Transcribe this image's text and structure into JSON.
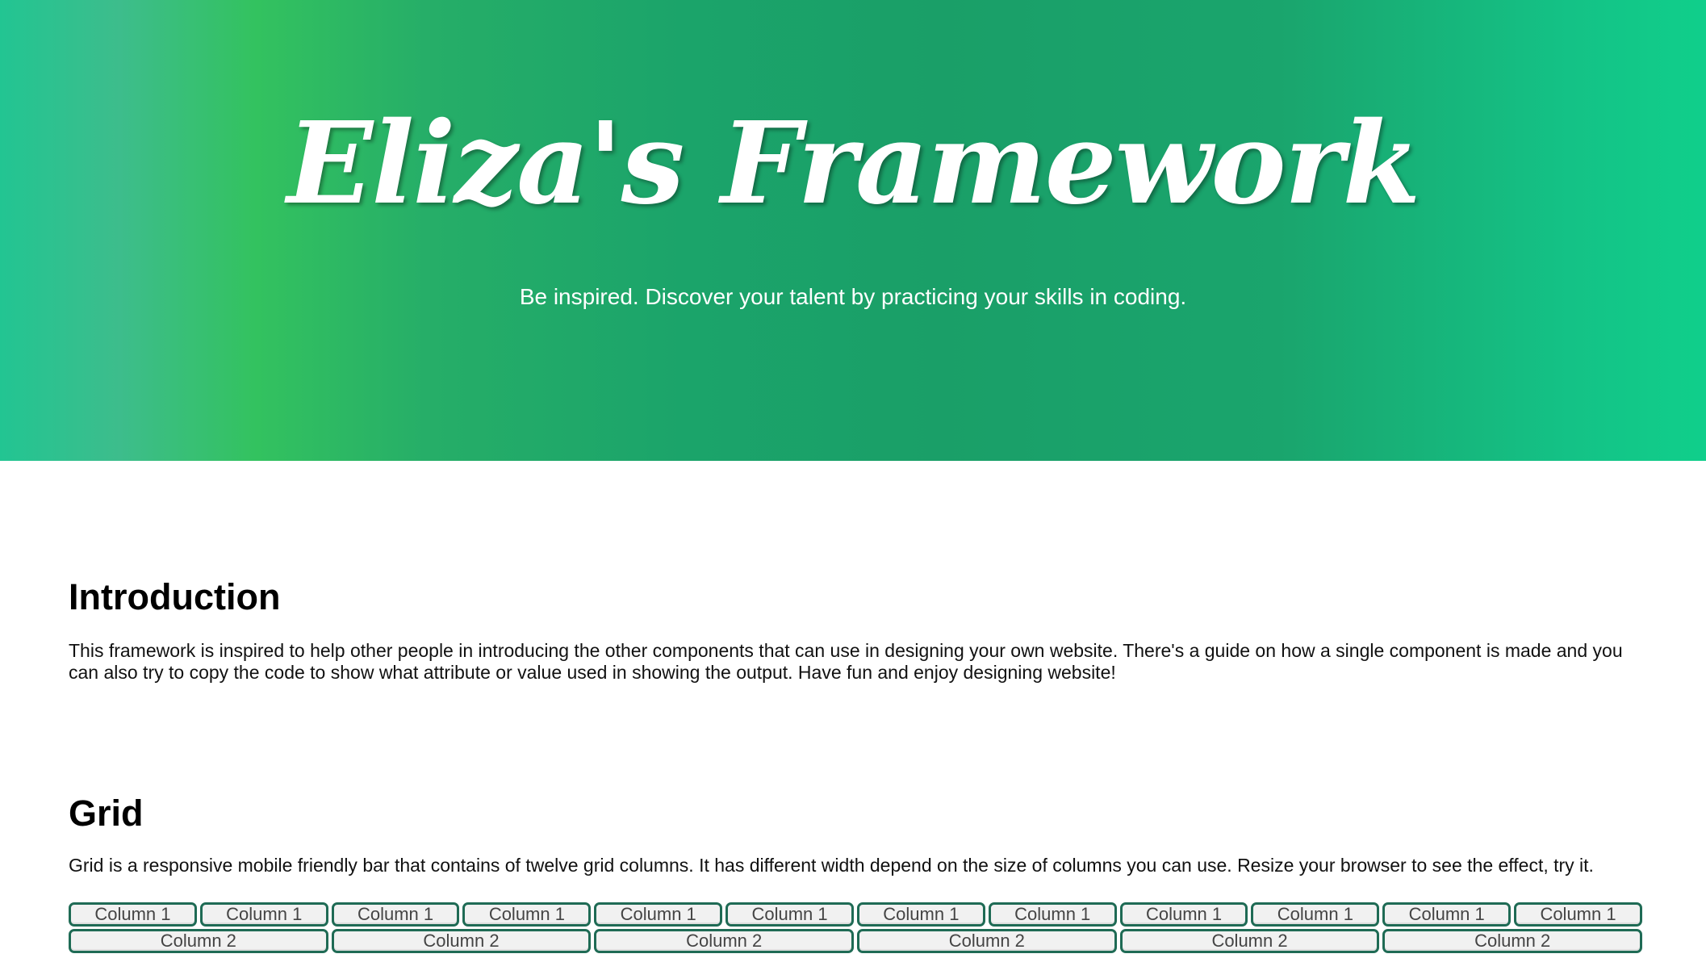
{
  "hero": {
    "title": "Eliza's Framework",
    "subtitle": "Be inspired. Discover your talent by practicing your skills in coding."
  },
  "intro": {
    "heading": "Introduction",
    "text": "This framework is inspired to help other people in introducing the other components that can use in designing your own website. There's a guide on how a single component is made and you can also try to copy the code to show what attribute or value used in showing the output. Have fun and enjoy designing website!"
  },
  "grid": {
    "heading": "Grid",
    "text": "Grid is a responsive mobile friendly bar that contains of twelve grid columns. It has different width depend on the size of columns you can use. Resize your browser to see the effect, try it.",
    "row1": [
      "Column 1",
      "Column 1",
      "Column 1",
      "Column 1",
      "Column 1",
      "Column 1",
      "Column 1",
      "Column 1",
      "Column 1",
      "Column 1",
      "Column 1",
      "Column 1"
    ],
    "row2": [
      "Column 2",
      "Column 2",
      "Column 2",
      "Column 2",
      "Column 2",
      "Column 2"
    ]
  },
  "colors": {
    "accent": "#1aa36b",
    "column_border": "#1f6b55"
  }
}
